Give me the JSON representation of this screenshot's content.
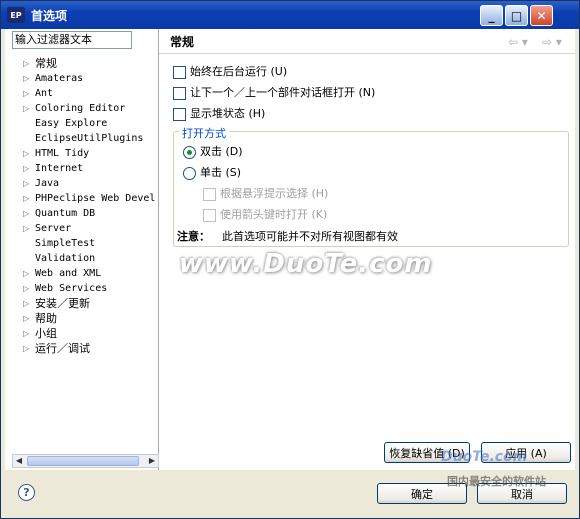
{
  "window": {
    "title": "首选项",
    "app_icon_text": "EP"
  },
  "filter": {
    "value": "输入过滤器文本"
  },
  "tree": [
    "常规",
    "Amateras",
    "Ant",
    "Coloring Editor",
    "Easy Explore",
    "EclipseUtilPlugins",
    "HTML Tidy",
    "Internet",
    "Java",
    "PHPeclipse Web Devel",
    "Quantum DB",
    "Server",
    "SimpleTest",
    "Validation",
    "Web and XML",
    "Web Services",
    "安装／更新",
    "帮助",
    "小组",
    "运行／调试"
  ],
  "tree_expandable": [
    true,
    true,
    true,
    true,
    false,
    false,
    true,
    true,
    true,
    true,
    true,
    true,
    false,
    false,
    true,
    true,
    true,
    true,
    true,
    true
  ],
  "page": {
    "title": "常规",
    "options": {
      "always_background": "始终在后台运行 (U)",
      "next_prev_dialog": "让下一个／上一个部件对话框打开 (N)",
      "show_heap": "显示堆状态 (H)"
    },
    "open_mode": {
      "group_title": "打开方式",
      "double_click": "双击 (D)",
      "single_click": "单击 (S)",
      "select_on_hover": "根据悬浮提示选择 (H)",
      "open_with_arrows": "使用箭头键时打开 (K)"
    },
    "note_label": "注意：",
    "note_text": "此首选项可能并不对所有视图都有效"
  },
  "buttons": {
    "restore_defaults": "恢复缺省值 (D)",
    "apply": "应用 (A)",
    "ok": "确定",
    "cancel": "取消"
  },
  "watermark": "www.DuoTe.com",
  "watermark_small": "DuoTe.com",
  "watermark_corner": "国内最安全的软件站"
}
